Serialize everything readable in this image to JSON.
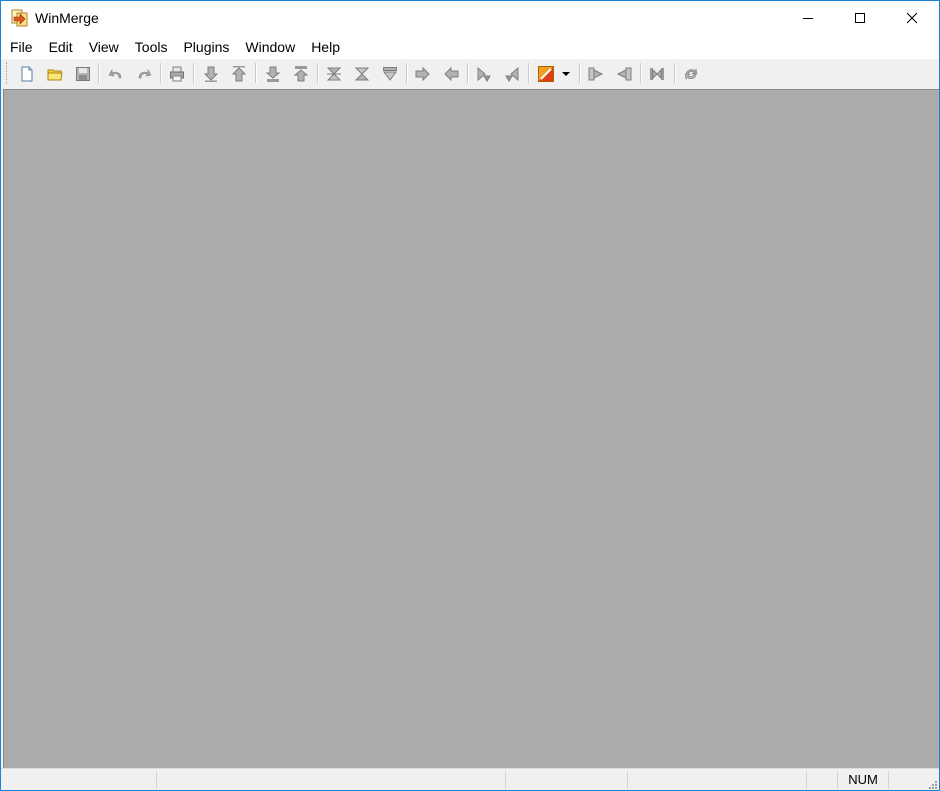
{
  "window": {
    "title": "WinMerge"
  },
  "menu": {
    "items": [
      "File",
      "Edit",
      "View",
      "Tools",
      "Plugins",
      "Window",
      "Help"
    ]
  },
  "toolbar": {
    "buttons": [
      {
        "name": "new-icon"
      },
      {
        "name": "open-icon"
      },
      {
        "name": "save-icon"
      },
      {
        "name": "undo-icon"
      },
      {
        "name": "redo-icon"
      },
      {
        "name": "print-icon"
      },
      {
        "name": "next-diff-icon"
      },
      {
        "name": "prev-diff-icon"
      },
      {
        "name": "first-diff-icon"
      },
      {
        "name": "last-diff-icon"
      },
      {
        "name": "current-diff-icon"
      },
      {
        "name": "next-conflict-icon"
      },
      {
        "name": "prev-conflict-icon"
      },
      {
        "name": "copy-right-icon"
      },
      {
        "name": "copy-left-icon"
      },
      {
        "name": "copy-right-advance-icon"
      },
      {
        "name": "copy-left-advance-icon"
      },
      {
        "name": "options-icon"
      },
      {
        "name": "all-right-icon"
      },
      {
        "name": "all-left-icon"
      },
      {
        "name": "compare-icon"
      },
      {
        "name": "refresh-icon"
      }
    ]
  },
  "statusbar": {
    "num_indicator": "NUM"
  },
  "colors": {
    "client_bg": "#ababab",
    "chrome_bg": "#f0f0f0",
    "border": "#1883d7"
  }
}
